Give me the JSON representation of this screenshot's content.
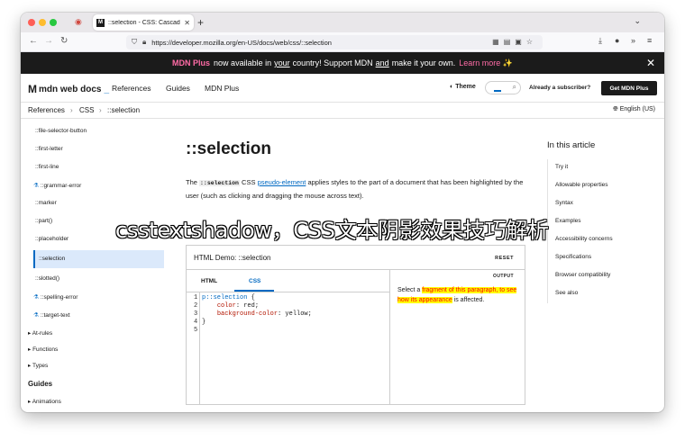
{
  "browser": {
    "tab_title": "::selection - CSS: Cascading St",
    "tab_favicon": "M",
    "url": "https://developer.mozilla.org/en-US/docs/web/css/::selection"
  },
  "banner": {
    "brand": "MDN Plus",
    "text_before": "now available in",
    "text_your": "your",
    "text_middle": "country! Support MDN",
    "text_and": "and",
    "text_after": "make it your own.",
    "learn_more": "Learn more ✨"
  },
  "header": {
    "logo": "mdn web docs",
    "nav": [
      "References",
      "Guides",
      "MDN Plus"
    ],
    "theme": "Theme",
    "already_subscriber": "Already a subscriber?",
    "get_plus": "Get MDN Plus"
  },
  "breadcrumbs": [
    "References",
    "CSS",
    "::selection"
  ],
  "language": "English (US)",
  "sidebar": {
    "items": [
      {
        "label": "::file-selector-button",
        "experimental": false
      },
      {
        "label": "::first-letter",
        "experimental": false
      },
      {
        "label": "::first-line",
        "experimental": false
      },
      {
        "label": "::grammar-error",
        "experimental": true
      },
      {
        "label": "::marker",
        "experimental": false
      },
      {
        "label": "::part()",
        "experimental": false
      },
      {
        "label": "::placeholder",
        "experimental": false
      },
      {
        "label": "::selection",
        "experimental": false
      },
      {
        "label": "::slotted()",
        "experimental": false
      },
      {
        "label": "::spelling-error",
        "experimental": true
      },
      {
        "label": "::target-text",
        "experimental": true
      }
    ],
    "groups": [
      "At-rules",
      "Functions",
      "Types"
    ],
    "guides_heading": "Guides",
    "guides_items": [
      "Animations"
    ]
  },
  "article": {
    "title": "::selection",
    "intro_a": "The",
    "intro_code": "::selection",
    "intro_b": "CSS",
    "intro_link": "pseudo-element",
    "intro_c": "applies styles to the part of a document that has been highlighted by the user (such as clicking and dragging the mouse across text)."
  },
  "demo": {
    "title": "HTML Demo: ::selection",
    "reset": "RESET",
    "tabs": [
      "HTML",
      "CSS"
    ],
    "active_tab": "CSS",
    "line_numbers": [
      "1",
      "2",
      "3",
      "4",
      "5"
    ],
    "code": {
      "l1_sel": "p::selection",
      "l1_brace": " {",
      "l2_prop": "color",
      "l2_val": ": red;",
      "l3_prop": "background-color",
      "l3_val": ": yellow;",
      "l4": "}"
    },
    "output_label": "OUTPUT",
    "output_a": "Select a",
    "output_hl": "fragment of this paragraph, to see how its appearance",
    "output_b": "is affected."
  },
  "toc": {
    "heading": "In this article",
    "items": [
      "Try it",
      "Allowable properties",
      "Syntax",
      "Examples",
      "Accessibility concerns",
      "Specifications",
      "Browser compatibility",
      "See also"
    ]
  },
  "overlay": {
    "caption": "csstextshadow，CSS文本阴影效果技巧解析",
    "ghost": "Try it"
  },
  "colors": {
    "accent": "#0069c2",
    "banner_bg": "#1b1b1b",
    "banner_accent": "#ff6ba6",
    "highlight_bg": "#ffff00",
    "highlight_fg": "#ff0000"
  }
}
